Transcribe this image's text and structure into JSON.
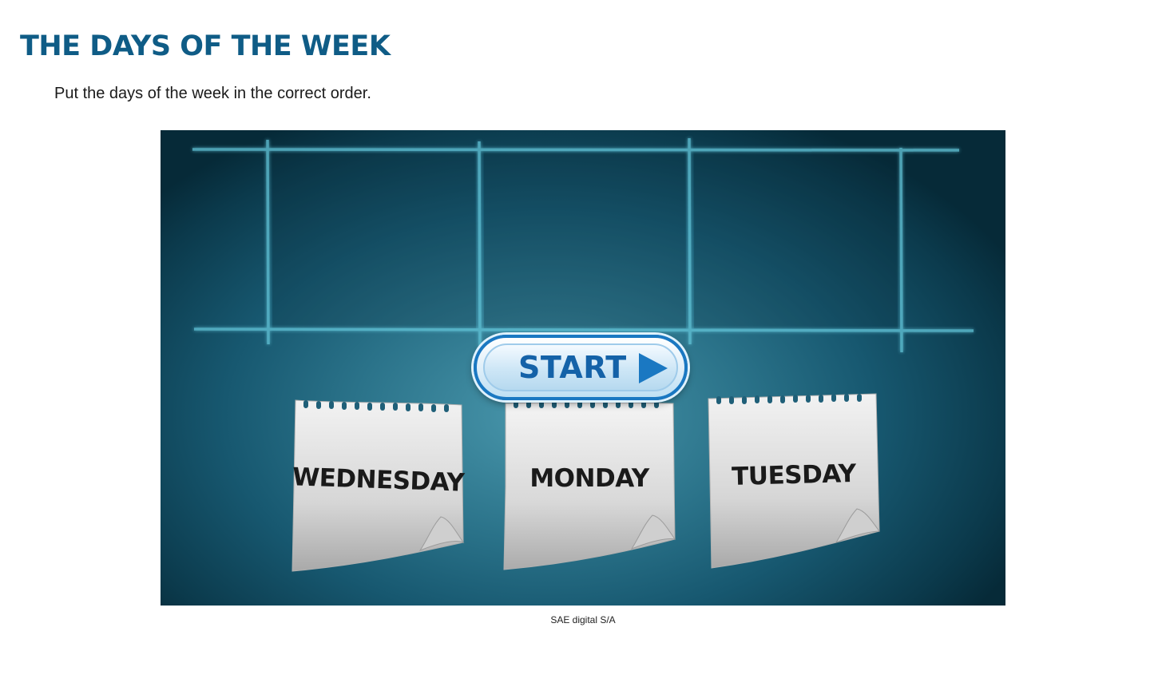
{
  "page": {
    "title": "THE DAYS OF THE WEEK",
    "instruction": "Put the days of the week in the correct order."
  },
  "game": {
    "start_label": "START",
    "start_icon": "play-icon",
    "cards": [
      {
        "label": "WEDNESDAY"
      },
      {
        "label": "MONDAY"
      },
      {
        "label": "TUESDAY"
      }
    ],
    "colors": {
      "background": "#175870",
      "grid_line": "#5fc0d4",
      "button_border": "#1a78c2",
      "button_text": "#1462a8",
      "title": "#0f5c86"
    }
  },
  "credit": "SAE digital S/A"
}
